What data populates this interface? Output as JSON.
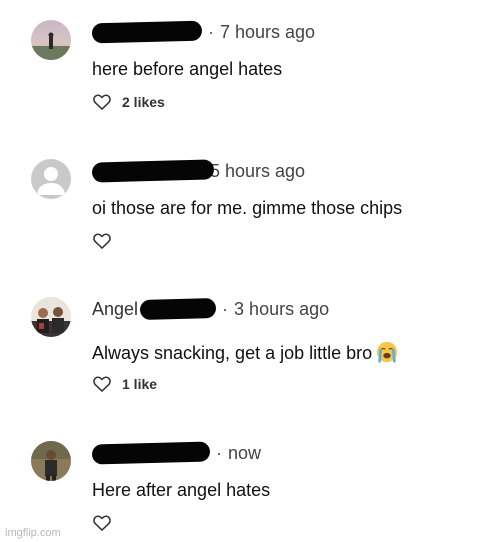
{
  "comments": [
    {
      "name": "",
      "time": "7 hours ago",
      "text": "here before angel hates",
      "likes": "2 likes",
      "avatar": "avatar-landscape-person"
    },
    {
      "name": "",
      "time": "5 hours ago",
      "text": "oi those are for me. gimme those chips",
      "likes": "",
      "avatar": "avatar-default-gray"
    },
    {
      "name": "Angel",
      "time": "3 hours ago",
      "text": "Always snacking, get a job little bro",
      "likes": "1 like",
      "avatar": "avatar-group-photo",
      "emoji": "crying-face-emoji"
    },
    {
      "name": "",
      "time": "now",
      "text": "Here after angel hates",
      "likes": "",
      "avatar": "avatar-person-outdoors"
    }
  ],
  "watermark": "imgflip.com",
  "colors": {
    "redaction": "#050505",
    "heart_stroke": "#333333",
    "emoji_face": "#f6c646",
    "tears": "#5aaee8"
  }
}
